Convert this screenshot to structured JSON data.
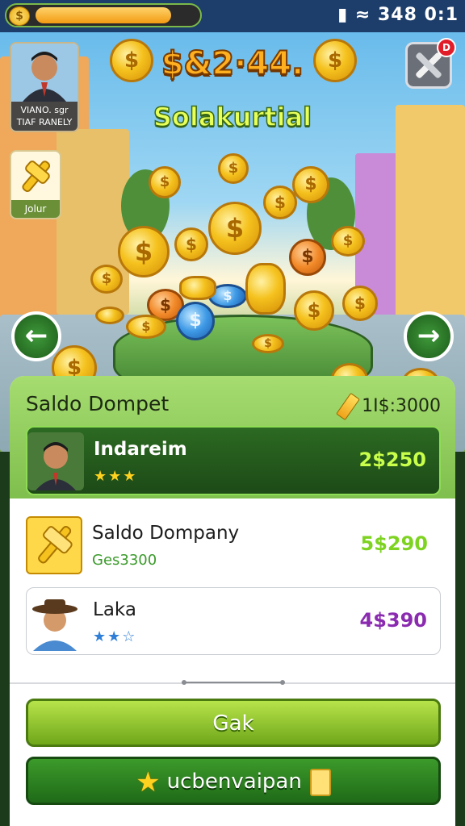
{
  "status_bar": {
    "coin_symbol": "$",
    "progress_fraction": 0.84,
    "system_text": "348 0:1"
  },
  "hero": {
    "balance": "$&2·44.",
    "subtitle": "Solakurtial"
  },
  "profile_card": {
    "caption_line1": "VIANO. sgr",
    "caption_line2": "TIAF RANELY"
  },
  "tool_badge": "D",
  "item_button": {
    "label": "Jolur"
  },
  "coin_symbol": "$",
  "wallet": {
    "title": "Saldo Dompet",
    "total": "1I$:3000",
    "rows": [
      {
        "name": "Indareim",
        "stars": "★★★",
        "amount": "2$250",
        "amount_color": "#c9ff4a"
      },
      {
        "name": "Saldo Dompany",
        "sub": "Ges3300",
        "amount": "5$290",
        "amount_color": "#7ed321"
      },
      {
        "name": "Laka",
        "stars": "★★☆",
        "amount": "4$390",
        "amount_color": "#8a2bb0"
      }
    ]
  },
  "buttons": {
    "primary": "Gak",
    "secondary": "ucbenvaipan"
  },
  "colors": {
    "accent_green": "#6fa71a",
    "dark_green": "#1f6a18",
    "gold": "#f5c21e"
  }
}
